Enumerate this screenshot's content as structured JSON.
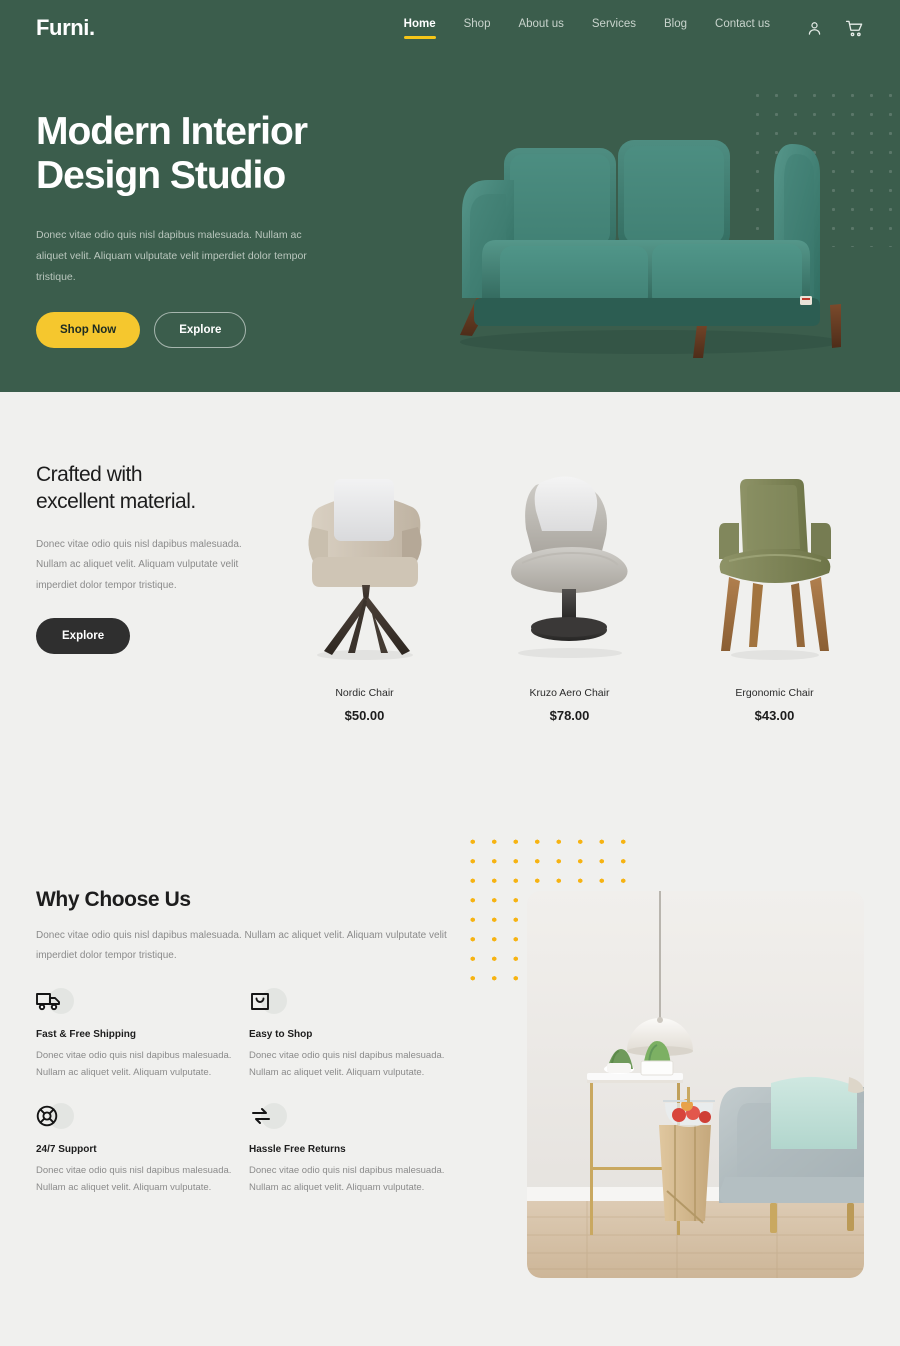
{
  "brand": {
    "logo": "Furni."
  },
  "nav": {
    "items": [
      {
        "label": "Home",
        "active": true
      },
      {
        "label": "Shop",
        "active": false
      },
      {
        "label": "About us",
        "active": false
      },
      {
        "label": "Services",
        "active": false
      },
      {
        "label": "Blog",
        "active": false
      },
      {
        "label": "Contact us",
        "active": false
      }
    ],
    "icons": [
      {
        "name": "user-icon"
      },
      {
        "name": "cart-icon"
      }
    ]
  },
  "hero": {
    "title_line1": "Modern Interior",
    "title_line2": "Design Studio",
    "subtitle": "Donec vitae odio quis nisl dapibus malesuada. Nullam ac aliquet velit. Aliquam vulputate velit imperdiet dolor tempor tristique.",
    "primary_button": "Shop Now",
    "secondary_button": "Explore",
    "bg_color": "#3b5d4c",
    "accent_color": "#f5c72e",
    "image_alt": "green velvet three-seat sofa"
  },
  "crafted": {
    "title_line1": "Crafted with",
    "title_line2": "excellent material.",
    "text": "Donec vitae odio quis nisl dapibus malesuada. Nullam ac aliquet velit. Aliquam vulputate velit imperdiet dolor tempor tristique.",
    "button": "Explore"
  },
  "products": [
    {
      "name": "Nordic Chair",
      "price": "$50.00",
      "image_alt": "beige armchair with white cushion and dark splayed wooden legs"
    },
    {
      "name": "Kruzo Aero Chair",
      "price": "$78.00",
      "image_alt": "grey lounge chair with white cushion on black pedestal base"
    },
    {
      "name": "Ergonomic Chair",
      "price": "$43.00",
      "image_alt": "olive green upholstered armchair with wooden legs"
    }
  ],
  "why": {
    "title": "Why Choose Us",
    "text": "Donec vitae odio quis nisl dapibus malesuada. Nullam ac aliquet velit. Aliquam vulputate velit imperdiet dolor tempor tristique.",
    "features": [
      {
        "icon": "truck-icon",
        "title": "Fast & Free Shipping",
        "text": "Donec vitae odio quis nisl dapibus malesuada. Nullam ac aliquet velit. Aliquam vulputate."
      },
      {
        "icon": "shopping-bag-icon",
        "title": "Easy to Shop",
        "text": "Donec vitae odio quis nisl dapibus malesuada. Nullam ac aliquet velit. Aliquam vulputate."
      },
      {
        "icon": "lifebuoy-support-icon",
        "title": "24/7 Support",
        "text": "Donec vitae odio quis nisl dapibus malesuada. Nullam ac aliquet velit. Aliquam vulputate."
      },
      {
        "icon": "exchange-arrows-icon",
        "title": "Hassle Free Returns",
        "text": "Donec vitae odio quis nisl dapibus malesuada. Nullam ac aliquet velit. Aliquam vulputate."
      }
    ],
    "dots_color": "#f6b312",
    "image_alt": "interior room with pendant lamp, gold console table with plants, wooden stool with fruit bowl and mint sofa"
  }
}
